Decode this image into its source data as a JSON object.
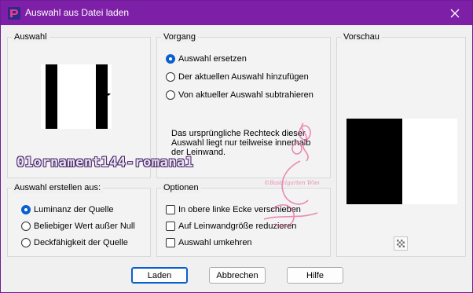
{
  "window": {
    "title": "Auswahl aus Datei laden"
  },
  "selection_group": {
    "legend": "Auswahl"
  },
  "operation_group": {
    "legend": "Vorgang",
    "options": [
      {
        "label": "Auswahl ersetzen",
        "checked": true
      },
      {
        "label": "Der aktuellen Auswahl hinzufügen",
        "checked": false
      },
      {
        "label": "Von aktueller Auswahl subtrahieren",
        "checked": false
      }
    ],
    "info": "Das ursprüngliche Rechteck dieser Auswahl liegt nur teilweise innerhalb der Leinwand."
  },
  "preview_group": {
    "legend": "Vorschau"
  },
  "create_from_group": {
    "legend": "Auswahl erstellen aus:",
    "options": [
      {
        "label": "Luminanz der Quelle",
        "checked": true
      },
      {
        "label": "Beliebiger Wert außer Null",
        "checked": false
      },
      {
        "label": "Deckfähigkeit der Quelle",
        "checked": false
      }
    ]
  },
  "options_group": {
    "legend": "Optionen",
    "checkboxes": [
      {
        "label": "In obere linke Ecke verschieben",
        "checked": false
      },
      {
        "label": "Auf Leinwandgröße reduzieren",
        "checked": false
      },
      {
        "label": "Auswahl umkehren",
        "checked": false
      }
    ]
  },
  "buttons": {
    "load": "Laden",
    "cancel": "Abbrechen",
    "help": "Hilfe"
  },
  "watermark": {
    "text": "01ornament144-romana1",
    "stamp": "©Bastelgarten Wien"
  },
  "colors": {
    "titlebar": "#7e1fa8",
    "accent": "#0a5fd0"
  }
}
